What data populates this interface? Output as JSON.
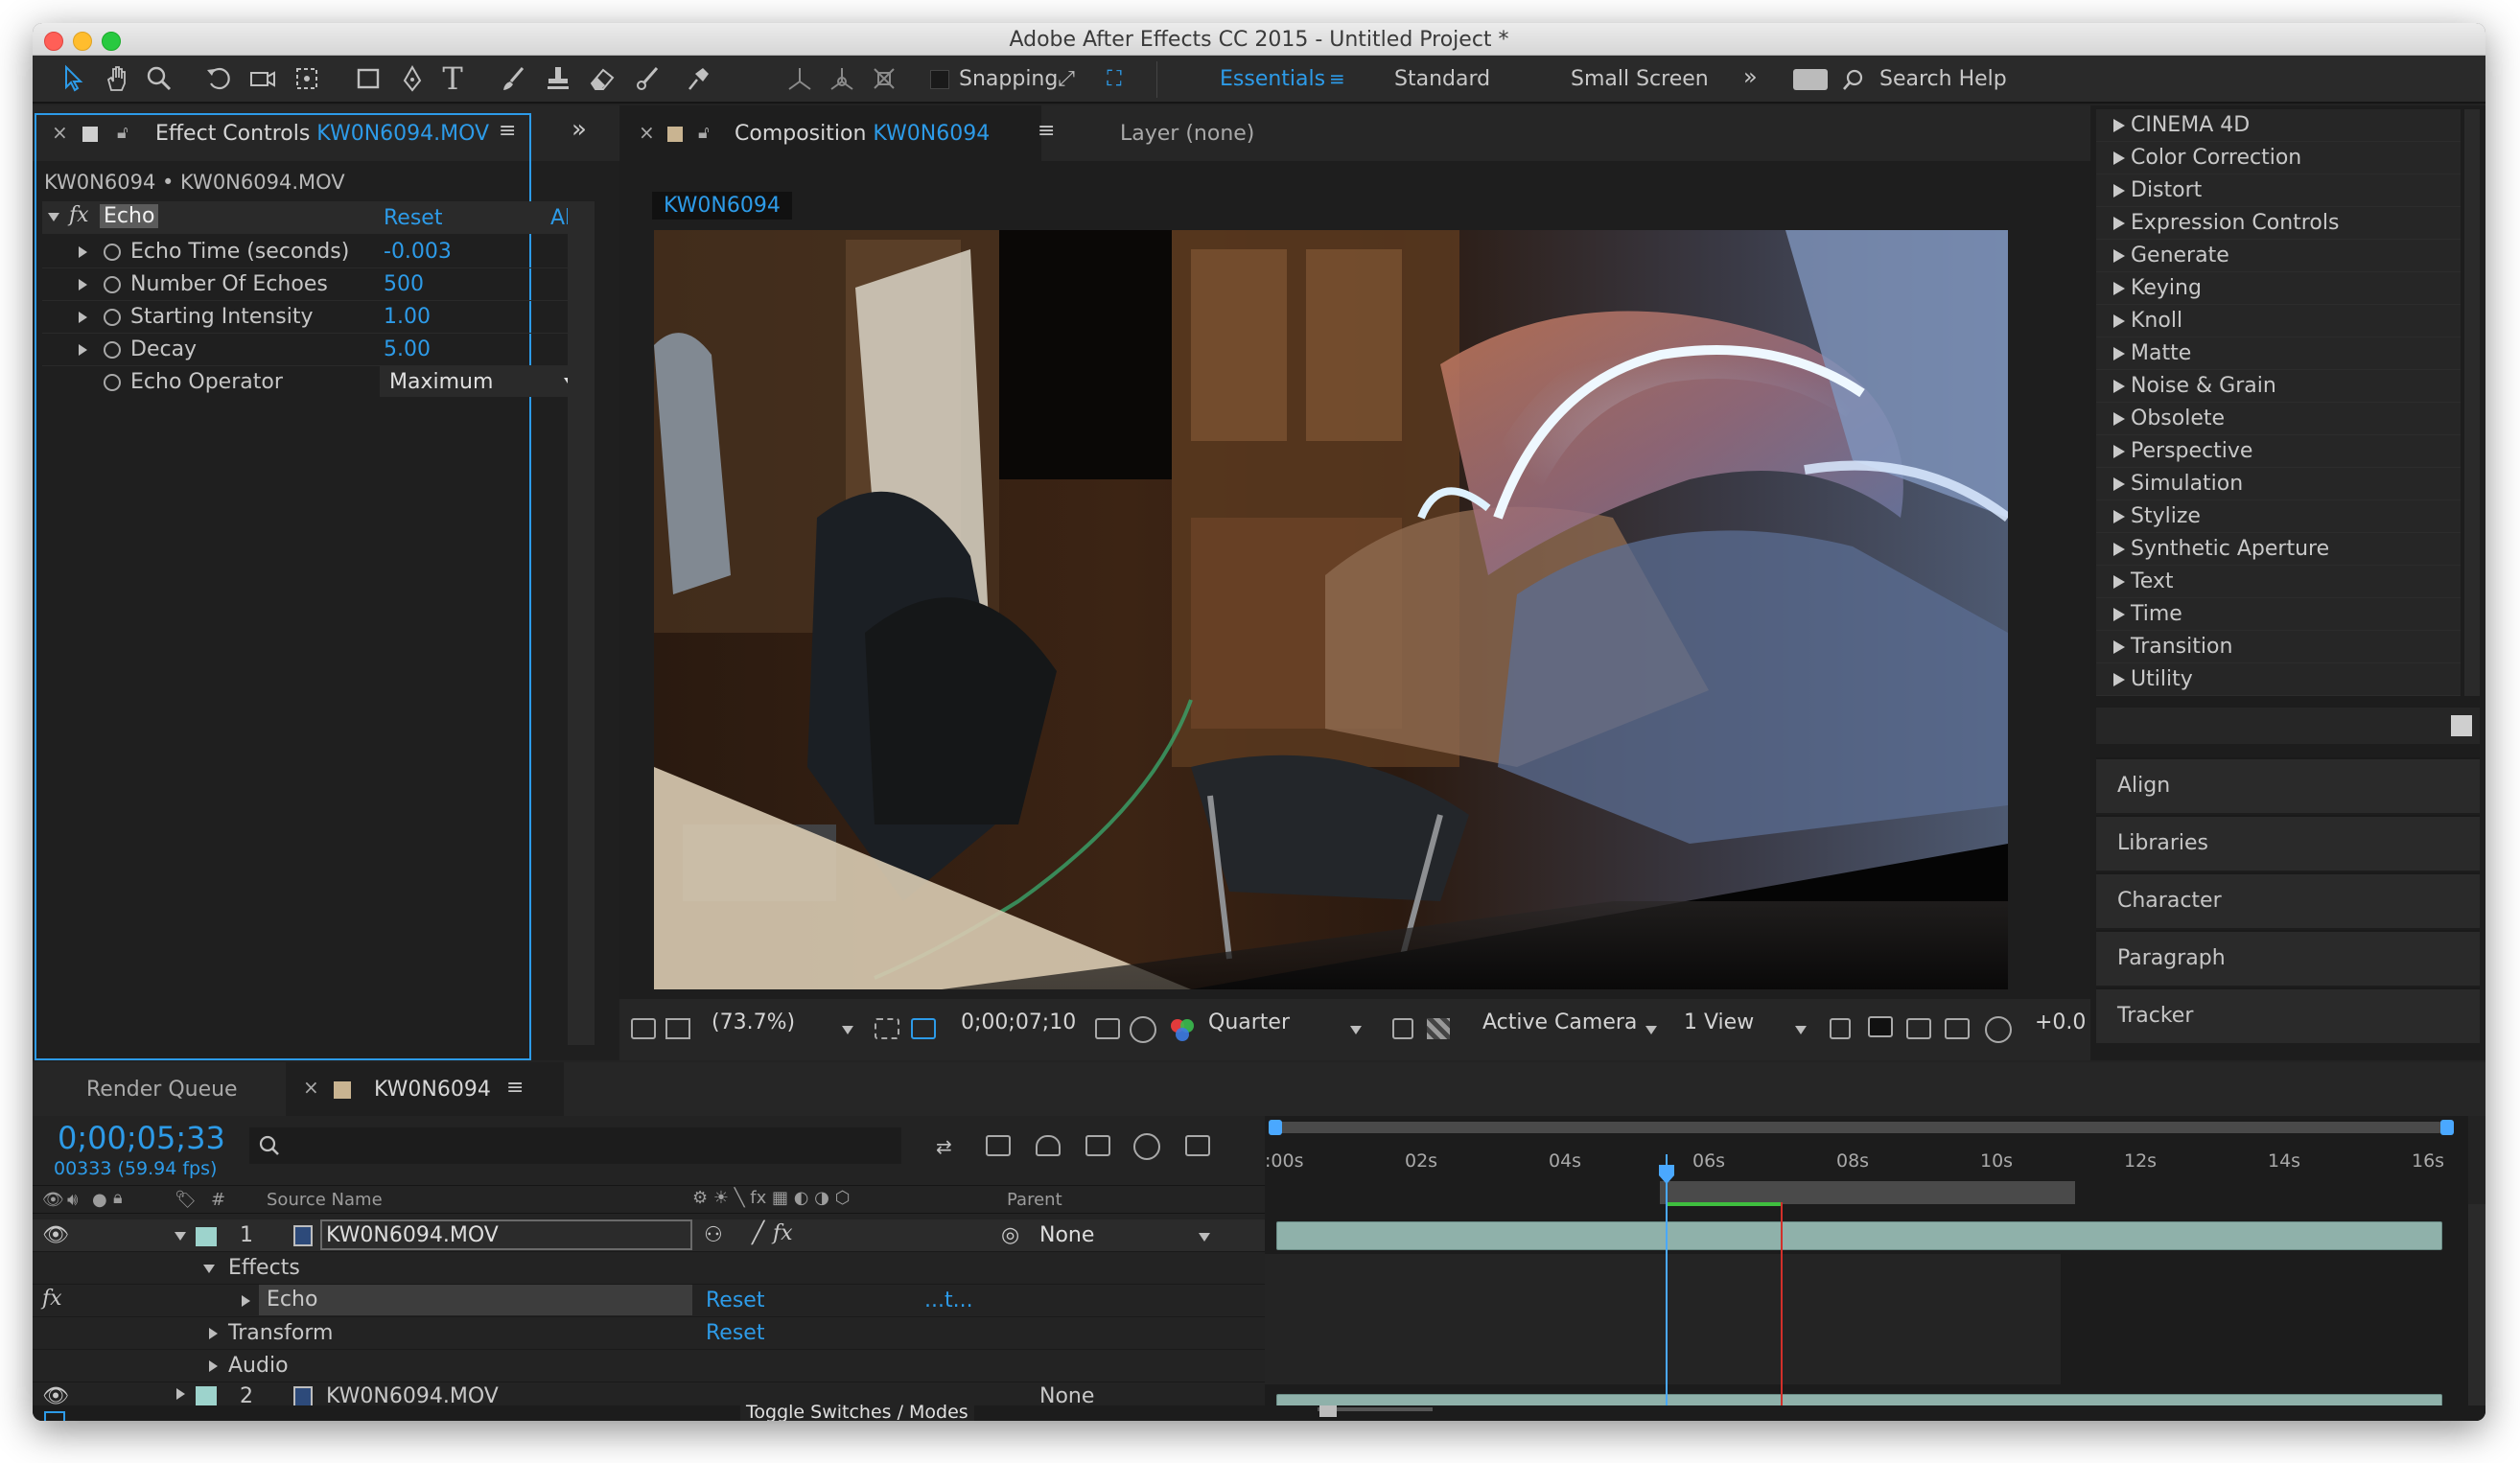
{
  "window": {
    "title": "Adobe After Effects CC 2015 - Untitled Project *"
  },
  "toolbar": {
    "snapping_label": "Snapping",
    "workspaces": [
      "Essentials",
      "Standard",
      "Small Screen"
    ],
    "search_label": "Search Help",
    "tools": [
      "selection-tool",
      "hand-tool",
      "zoom-tool",
      "rotation-tool",
      "camera-tool",
      "pan-behind-tool",
      "rectangle-tool",
      "pen-tool",
      "type-tool",
      "brush-tool",
      "clone-stamp-tool",
      "eraser-tool",
      "roto-brush-tool",
      "puppet-pin-tool"
    ]
  },
  "effect_controls": {
    "tab_prefix": "Effect Controls",
    "tab_file": "KW0N6094.MOV",
    "breadcrumb": "KW0N6094 • KW0N6094.MOV",
    "effect_name": "Echo",
    "reset_label": "Reset",
    "about_label": "Ab",
    "properties": [
      {
        "name": "Echo Time (seconds)",
        "value": "-0.003"
      },
      {
        "name": "Number Of Echoes",
        "value": "500"
      },
      {
        "name": "Starting Intensity",
        "value": "1.00"
      },
      {
        "name": "Decay",
        "value": "5.00"
      },
      {
        "name": "Echo Operator",
        "value": "Maximum"
      }
    ]
  },
  "composition": {
    "tab_prefix": "Composition",
    "tab_name": "KW0N6094",
    "layer_tab": "Layer (none)",
    "comp_chip": "KW0N6094"
  },
  "viewer_bar": {
    "zoom": "(73.7%)",
    "timecode": "0;00;07;10",
    "resolution": "Quarter",
    "camera": "Active Camera",
    "views": "1 View",
    "exposure": "+0.0"
  },
  "effects_presets": {
    "categories": [
      "CINEMA 4D",
      "Color Correction",
      "Distort",
      "Expression Controls",
      "Generate",
      "Keying",
      "Knoll",
      "Matte",
      "Noise & Grain",
      "Obsolete",
      "Perspective",
      "Simulation",
      "Stylize",
      "Synthetic Aperture",
      "Text",
      "Time",
      "Transition",
      "Utility"
    ]
  },
  "right_panels": [
    "Align",
    "Libraries",
    "Character",
    "Paragraph",
    "Tracker"
  ],
  "timeline": {
    "render_queue_tab": "Render Queue",
    "comp_tab": "KW0N6094",
    "timecode": "0;00;05;33",
    "frame_info": "00333 (59.94 fps)",
    "col_hash": "#",
    "col_source": "Source Name",
    "col_parent": "Parent",
    "ruler_labels": [
      ":00s",
      "02s",
      "04s",
      "06s",
      "08s",
      "10s",
      "12s",
      "14s",
      "16s"
    ],
    "layer1": {
      "num": "1",
      "name": "KW0N6094.MOV",
      "parent": "None"
    },
    "effects_label": "Effects",
    "echo_label": "Echo",
    "echo_reset": "Reset",
    "echo_dots": "...t...",
    "transform_label": "Transform",
    "transform_reset": "Reset",
    "audio_label": "Audio",
    "layer2": {
      "num": "2",
      "name": "KW0N6094.MOV",
      "parent": "None"
    },
    "toggle_label": "Toggle Switches / Modes",
    "current_time_fraction": 0.333,
    "work_area_end_fraction": 0.683
  },
  "colors": {
    "accent": "#2d9be8",
    "panel_bg": "#232323",
    "layer_bar": "#8fb1aa",
    "playhead": "#4aa8ff",
    "cti_red": "#d2302a"
  }
}
